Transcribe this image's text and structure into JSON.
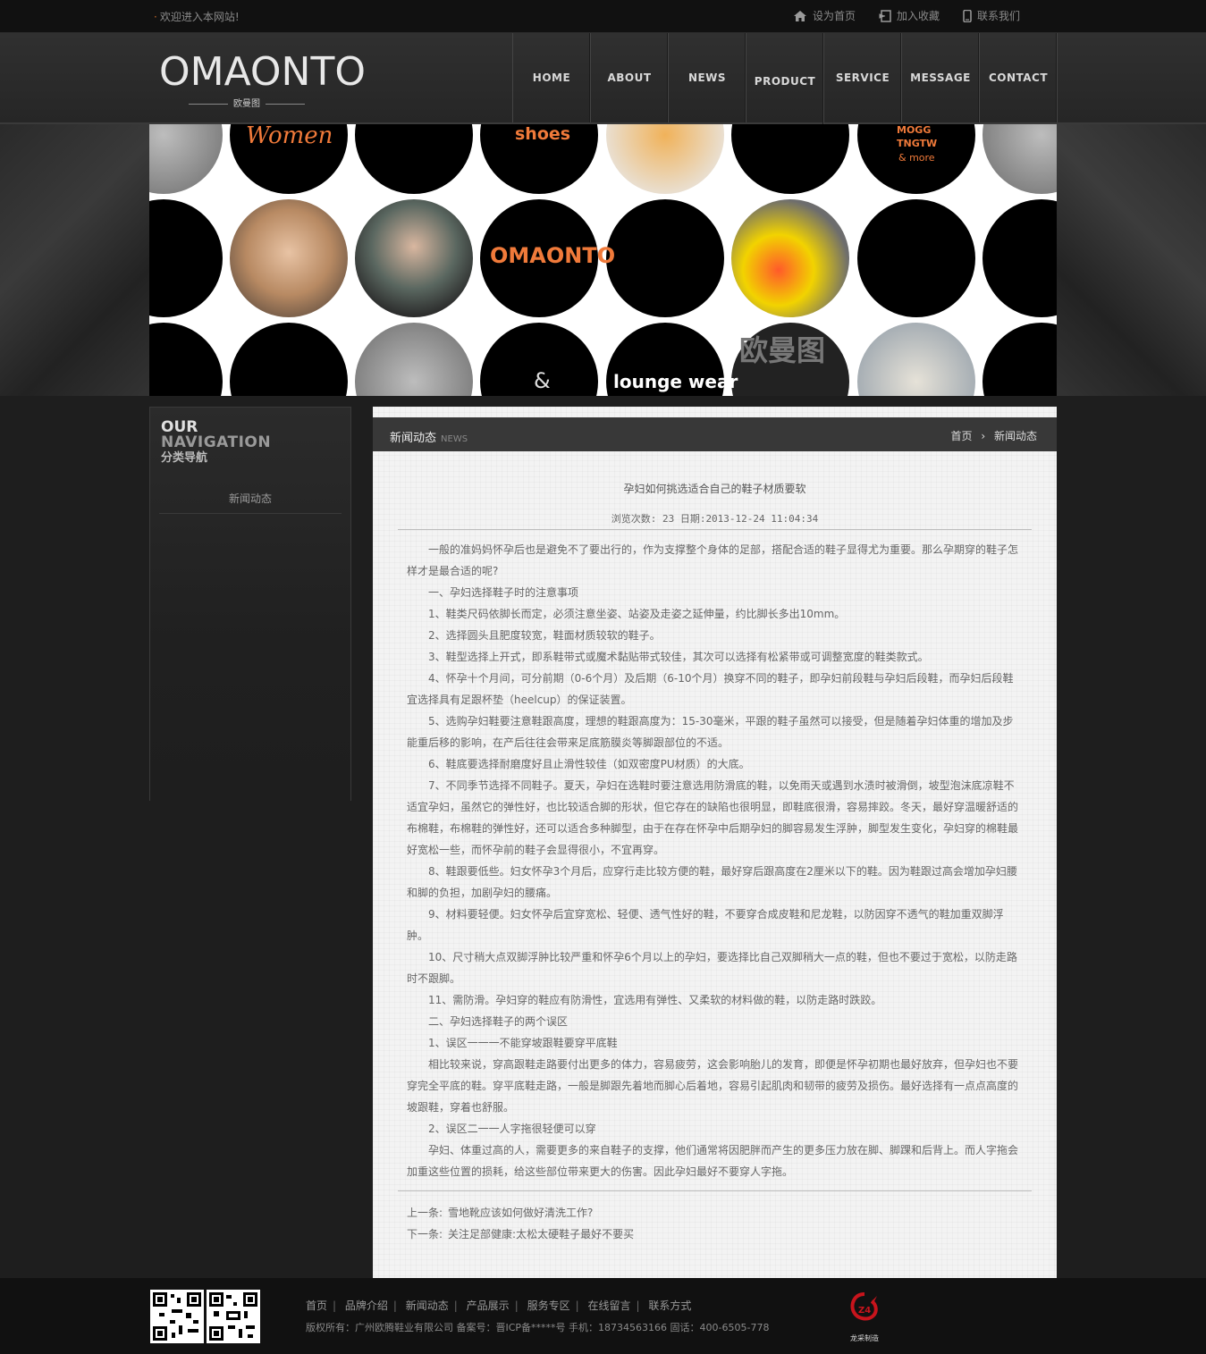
{
  "topbar": {
    "welcome": "欢迎进入本网站!",
    "links": [
      {
        "label": "设为首页",
        "icon": "home-icon"
      },
      {
        "label": "加入收藏",
        "icon": "bookmark-icon"
      },
      {
        "label": "联系我们",
        "icon": "phone-icon"
      }
    ]
  },
  "header": {
    "logo_text": "OMAONTO",
    "logo_sub": "欧曼图",
    "nav": [
      "HOME",
      "ABOUT",
      "NEWS",
      "PRODUCT",
      "SERVICE",
      "MESSAGE",
      "CONTACT"
    ]
  },
  "banner": {
    "texts": {
      "women": "Women",
      "shoes": "shoes",
      "mogg": "MOGG",
      "tngtw": "TNGTW",
      "more": "& more",
      "omaonto": "OMAONTO",
      "amp": "&",
      "lounge": "lounge wear",
      "cn": "欧曼图"
    }
  },
  "sidebar": {
    "title_l1": "OUR",
    "title_l2": "NAVIGATION",
    "title_l3": "分类导航",
    "items": [
      "新闻动态"
    ]
  },
  "main": {
    "section_title": "新闻动态",
    "section_en": "NEWS",
    "breadcrumb_home": "首页",
    "breadcrumb_current": "新闻动态",
    "article_title": "孕妇如何挑选适合自己的鞋子材质要软",
    "meta": "浏览次数: 23 日期:2013-12-24 11:04:34",
    "paragraphs": [
      "一般的准妈妈怀孕后也是避免不了要出行的，作为支撑整个身体的足部，搭配合适的鞋子显得尤为重要。那么孕期穿的鞋子怎样才是最合适的呢?",
      "一、孕妇选择鞋子时的注意事项",
      "1、鞋类尺码依脚长而定，必须注意坐姿、站姿及走姿之延伸量，约比脚长多出10mm。",
      "2、选择圆头且肥度较宽，鞋面材质较软的鞋子。",
      "3、鞋型选择上开式，即系鞋带式或魔术黏贴带式较佳，其次可以选择有松紧带或可调整宽度的鞋类款式。",
      "4、怀孕十个月间，可分前期（0-6个月）及后期（6-10个月）换穿不同的鞋子，即孕妇前段鞋与孕妇后段鞋，而孕妇后段鞋宜选择具有足跟杯垫（heelcup）的保证装置。",
      "5、选购孕妇鞋要注意鞋跟高度，理想的鞋跟高度为：15-30毫米，平跟的鞋子虽然可以接受，但是随着孕妇体重的增加及步能重后移的影响，在产后往往会带来足底筋膜炎等脚跟部位的不适。",
      "6、鞋底要选择耐磨度好且止滑性较佳（如双密度PU材质）的大底。",
      "7、不同季节选择不同鞋子。夏天，孕妇在选鞋时要注意选用防滑底的鞋，以免雨天或遇到水渍时被滑倒，坡型泡沫底凉鞋不适宜孕妇，虽然它的弹性好，也比较适合脚的形状，但它存在的缺陷也很明显，即鞋底很滑，容易摔跤。冬天，最好穿温暖舒适的布棉鞋，布棉鞋的弹性好，还可以适合多种脚型，由于在存在怀孕中后期孕妇的脚容易发生浮肿，脚型发生变化，孕妇穿的棉鞋最好宽松一些，而怀孕前的鞋子会显得很小，不宜再穿。",
      "8、鞋跟要低些。妇女怀孕3个月后，应穿行走比较方便的鞋，最好穿后跟高度在2厘米以下的鞋。因为鞋跟过高会增加孕妇腰和脚的负担，加剧孕妇的腰痛。",
      "9、材料要轻便。妇女怀孕后宜穿宽松、轻便、透气性好的鞋，不要穿合成皮鞋和尼龙鞋，以防因穿不透气的鞋加重双脚浮肿。",
      "10、尺寸稍大点双脚浮肿比较严重和怀孕6个月以上的孕妇，要选择比自己双脚稍大一点的鞋，但也不要过于宽松，以防走路时不跟脚。",
      "11、需防滑。孕妇穿的鞋应有防滑性，宜选用有弹性、又柔软的材料做的鞋，以防走路时跌跤。",
      "二、孕妇选择鞋子的两个误区",
      "1、误区一一一不能穿坡跟鞋要穿平底鞋",
      "相比较来说，穿高跟鞋走路要付出更多的体力，容易疲劳，这会影响胎儿的发育，即便是怀孕初期也最好放弃，但孕妇也不要穿完全平底的鞋。穿平底鞋走路，一般是脚跟先着地而脚心后着地，容易引起肌肉和韧带的疲劳及损伤。最好选择有一点点高度的坡跟鞋，穿着也舒服。",
      "2、误区二一一人字拖很轻便可以穿",
      "孕妇、体重过高的人，需要更多的来自鞋子的支撑，他们通常将因肥胖而产生的更多压力放在脚、脚踝和后背上。而人字拖会加重这些位置的损耗，给这些部位带来更大的伤害。因此孕妇最好不要穿人字拖。"
    ],
    "prev_label": "上一条:",
    "prev_title": "雪地靴应该如何做好清洗工作?",
    "next_label": "下一条:",
    "next_title": "关注足部健康:太松太硬鞋子最好不要买"
  },
  "footer": {
    "links": [
      "首页",
      "品牌介绍",
      "新闻动态",
      "产品展示",
      "服务专区",
      "在线留言",
      "联系方式"
    ],
    "copyright": "版权所有：广州欧腾鞋业有限公司  备案号：晋ICP备*****号  手机：18734563166    固话：400-6505-778",
    "maker": "龙采制造",
    "maker_mark": "Z4"
  },
  "colors": {
    "accent_orange": "#f07a3a",
    "page_bg": "#1e1e1e",
    "content_bg": "#f3f3f3"
  }
}
